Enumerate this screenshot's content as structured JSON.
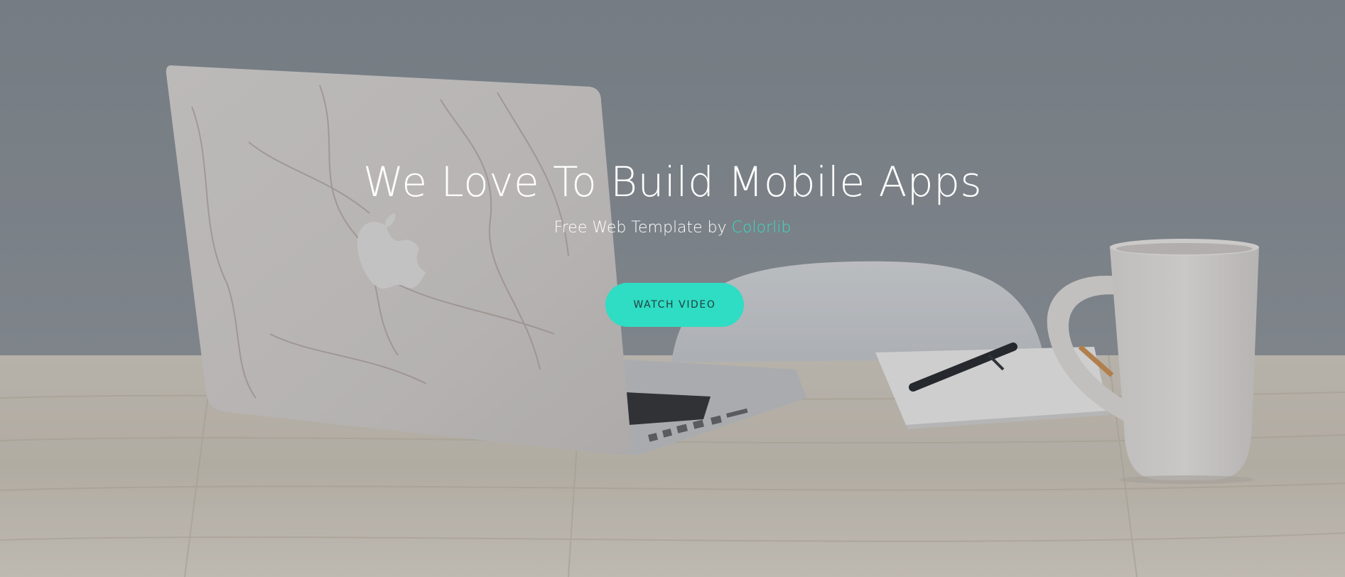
{
  "hero": {
    "title": "We Love To Build Mobile Apps",
    "subtitle_prefix": "Free Web Template by ",
    "subtitle_link": "Colorlib",
    "cta_label": "WATCH VIDEO",
    "colors": {
      "accent": "#2fdcc4",
      "link": "#3ad8c6",
      "overlay": "#6b7075"
    }
  }
}
